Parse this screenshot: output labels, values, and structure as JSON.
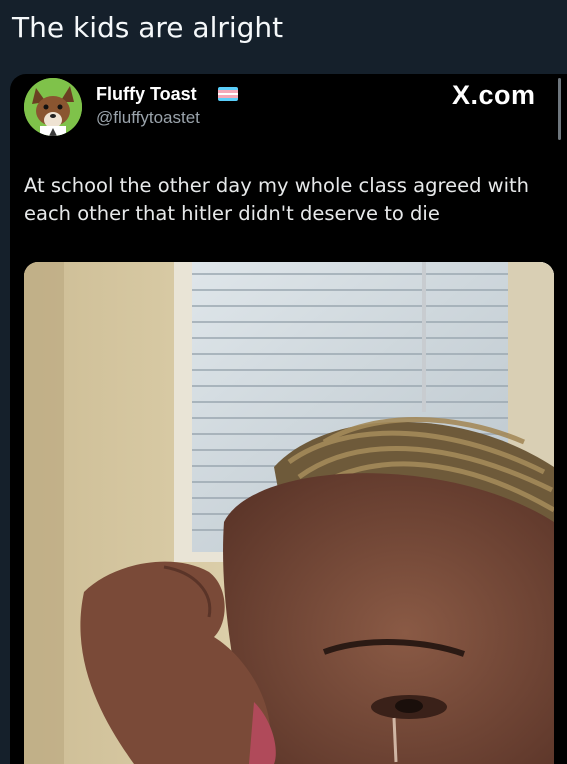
{
  "caption": "The kids are alright",
  "tweet": {
    "display_name": "Fluffy Toast",
    "handle": "@fluffytoastet",
    "brand": "X.com",
    "text": "At school the other day my whole class agreed with each other that hitler didn't deserve to die",
    "flag_colors": [
      "#5bcefa",
      "#f5a9b8",
      "#ffffff",
      "#f5a9b8",
      "#5bcefa"
    ]
  },
  "photo": {
    "subject": "crying selfie by window blinds"
  },
  "colors": {
    "page_background": "#15202b",
    "card_background": "#000000",
    "handle_text": "#9aa3ab"
  }
}
